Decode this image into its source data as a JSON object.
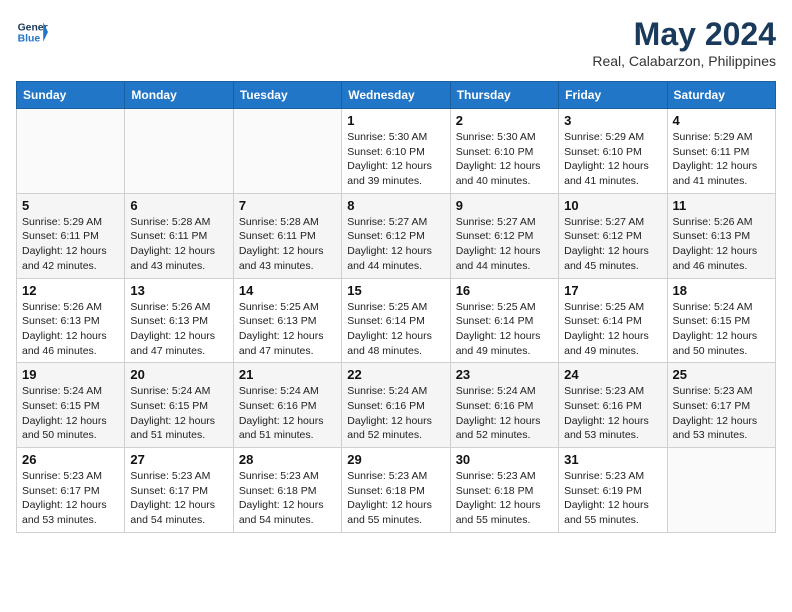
{
  "header": {
    "logo_line1": "General",
    "logo_line2": "Blue",
    "month_year": "May 2024",
    "location": "Real, Calabarzon, Philippines"
  },
  "days_of_week": [
    "Sunday",
    "Monday",
    "Tuesday",
    "Wednesday",
    "Thursday",
    "Friday",
    "Saturday"
  ],
  "weeks": [
    [
      {
        "day": "",
        "info": ""
      },
      {
        "day": "",
        "info": ""
      },
      {
        "day": "",
        "info": ""
      },
      {
        "day": "1",
        "info": "Sunrise: 5:30 AM\nSunset: 6:10 PM\nDaylight: 12 hours\nand 39 minutes."
      },
      {
        "day": "2",
        "info": "Sunrise: 5:30 AM\nSunset: 6:10 PM\nDaylight: 12 hours\nand 40 minutes."
      },
      {
        "day": "3",
        "info": "Sunrise: 5:29 AM\nSunset: 6:10 PM\nDaylight: 12 hours\nand 41 minutes."
      },
      {
        "day": "4",
        "info": "Sunrise: 5:29 AM\nSunset: 6:11 PM\nDaylight: 12 hours\nand 41 minutes."
      }
    ],
    [
      {
        "day": "5",
        "info": "Sunrise: 5:29 AM\nSunset: 6:11 PM\nDaylight: 12 hours\nand 42 minutes."
      },
      {
        "day": "6",
        "info": "Sunrise: 5:28 AM\nSunset: 6:11 PM\nDaylight: 12 hours\nand 43 minutes."
      },
      {
        "day": "7",
        "info": "Sunrise: 5:28 AM\nSunset: 6:11 PM\nDaylight: 12 hours\nand 43 minutes."
      },
      {
        "day": "8",
        "info": "Sunrise: 5:27 AM\nSunset: 6:12 PM\nDaylight: 12 hours\nand 44 minutes."
      },
      {
        "day": "9",
        "info": "Sunrise: 5:27 AM\nSunset: 6:12 PM\nDaylight: 12 hours\nand 44 minutes."
      },
      {
        "day": "10",
        "info": "Sunrise: 5:27 AM\nSunset: 6:12 PM\nDaylight: 12 hours\nand 45 minutes."
      },
      {
        "day": "11",
        "info": "Sunrise: 5:26 AM\nSunset: 6:13 PM\nDaylight: 12 hours\nand 46 minutes."
      }
    ],
    [
      {
        "day": "12",
        "info": "Sunrise: 5:26 AM\nSunset: 6:13 PM\nDaylight: 12 hours\nand 46 minutes."
      },
      {
        "day": "13",
        "info": "Sunrise: 5:26 AM\nSunset: 6:13 PM\nDaylight: 12 hours\nand 47 minutes."
      },
      {
        "day": "14",
        "info": "Sunrise: 5:25 AM\nSunset: 6:13 PM\nDaylight: 12 hours\nand 47 minutes."
      },
      {
        "day": "15",
        "info": "Sunrise: 5:25 AM\nSunset: 6:14 PM\nDaylight: 12 hours\nand 48 minutes."
      },
      {
        "day": "16",
        "info": "Sunrise: 5:25 AM\nSunset: 6:14 PM\nDaylight: 12 hours\nand 49 minutes."
      },
      {
        "day": "17",
        "info": "Sunrise: 5:25 AM\nSunset: 6:14 PM\nDaylight: 12 hours\nand 49 minutes."
      },
      {
        "day": "18",
        "info": "Sunrise: 5:24 AM\nSunset: 6:15 PM\nDaylight: 12 hours\nand 50 minutes."
      }
    ],
    [
      {
        "day": "19",
        "info": "Sunrise: 5:24 AM\nSunset: 6:15 PM\nDaylight: 12 hours\nand 50 minutes."
      },
      {
        "day": "20",
        "info": "Sunrise: 5:24 AM\nSunset: 6:15 PM\nDaylight: 12 hours\nand 51 minutes."
      },
      {
        "day": "21",
        "info": "Sunrise: 5:24 AM\nSunset: 6:16 PM\nDaylight: 12 hours\nand 51 minutes."
      },
      {
        "day": "22",
        "info": "Sunrise: 5:24 AM\nSunset: 6:16 PM\nDaylight: 12 hours\nand 52 minutes."
      },
      {
        "day": "23",
        "info": "Sunrise: 5:24 AM\nSunset: 6:16 PM\nDaylight: 12 hours\nand 52 minutes."
      },
      {
        "day": "24",
        "info": "Sunrise: 5:23 AM\nSunset: 6:16 PM\nDaylight: 12 hours\nand 53 minutes."
      },
      {
        "day": "25",
        "info": "Sunrise: 5:23 AM\nSunset: 6:17 PM\nDaylight: 12 hours\nand 53 minutes."
      }
    ],
    [
      {
        "day": "26",
        "info": "Sunrise: 5:23 AM\nSunset: 6:17 PM\nDaylight: 12 hours\nand 53 minutes."
      },
      {
        "day": "27",
        "info": "Sunrise: 5:23 AM\nSunset: 6:17 PM\nDaylight: 12 hours\nand 54 minutes."
      },
      {
        "day": "28",
        "info": "Sunrise: 5:23 AM\nSunset: 6:18 PM\nDaylight: 12 hours\nand 54 minutes."
      },
      {
        "day": "29",
        "info": "Sunrise: 5:23 AM\nSunset: 6:18 PM\nDaylight: 12 hours\nand 55 minutes."
      },
      {
        "day": "30",
        "info": "Sunrise: 5:23 AM\nSunset: 6:18 PM\nDaylight: 12 hours\nand 55 minutes."
      },
      {
        "day": "31",
        "info": "Sunrise: 5:23 AM\nSunset: 6:19 PM\nDaylight: 12 hours\nand 55 minutes."
      },
      {
        "day": "",
        "info": ""
      }
    ]
  ]
}
